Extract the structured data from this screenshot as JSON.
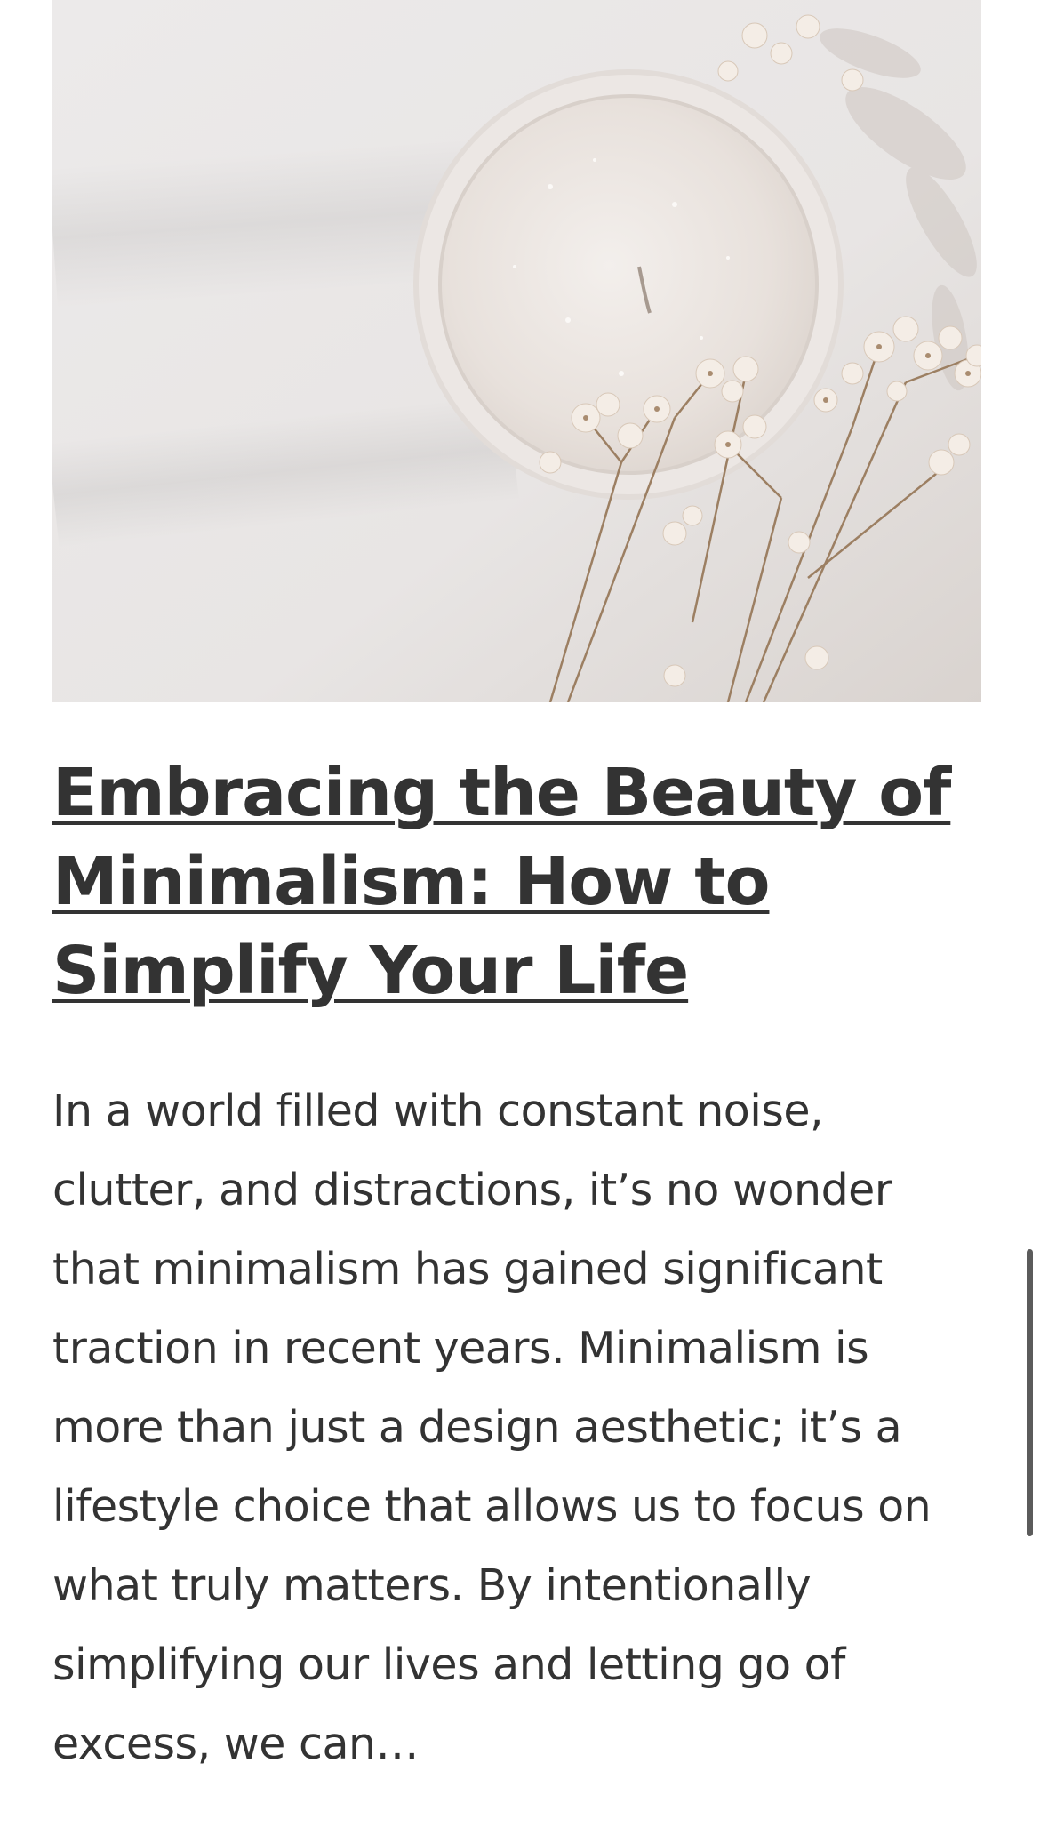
{
  "article": {
    "image": {
      "subject": "candle-with-dried-flowers"
    },
    "title": "Embracing the Beauty of Minimalism: How to Simplify Your Life",
    "excerpt": "In a world filled with constant noise, clutter, and distractions, it’s no wonder that minimalism has gained significant traction in recent years. Minimalism is more than just a design aesthetic; it’s a lifestyle choice that allows us to focus on what truly matters. By intentionally simplifying our lives and letting go of excess, we can…"
  },
  "colors": {
    "text": "#333333",
    "scrollbar": "#5b5b5b",
    "photo_background": "#e9e7e6"
  }
}
